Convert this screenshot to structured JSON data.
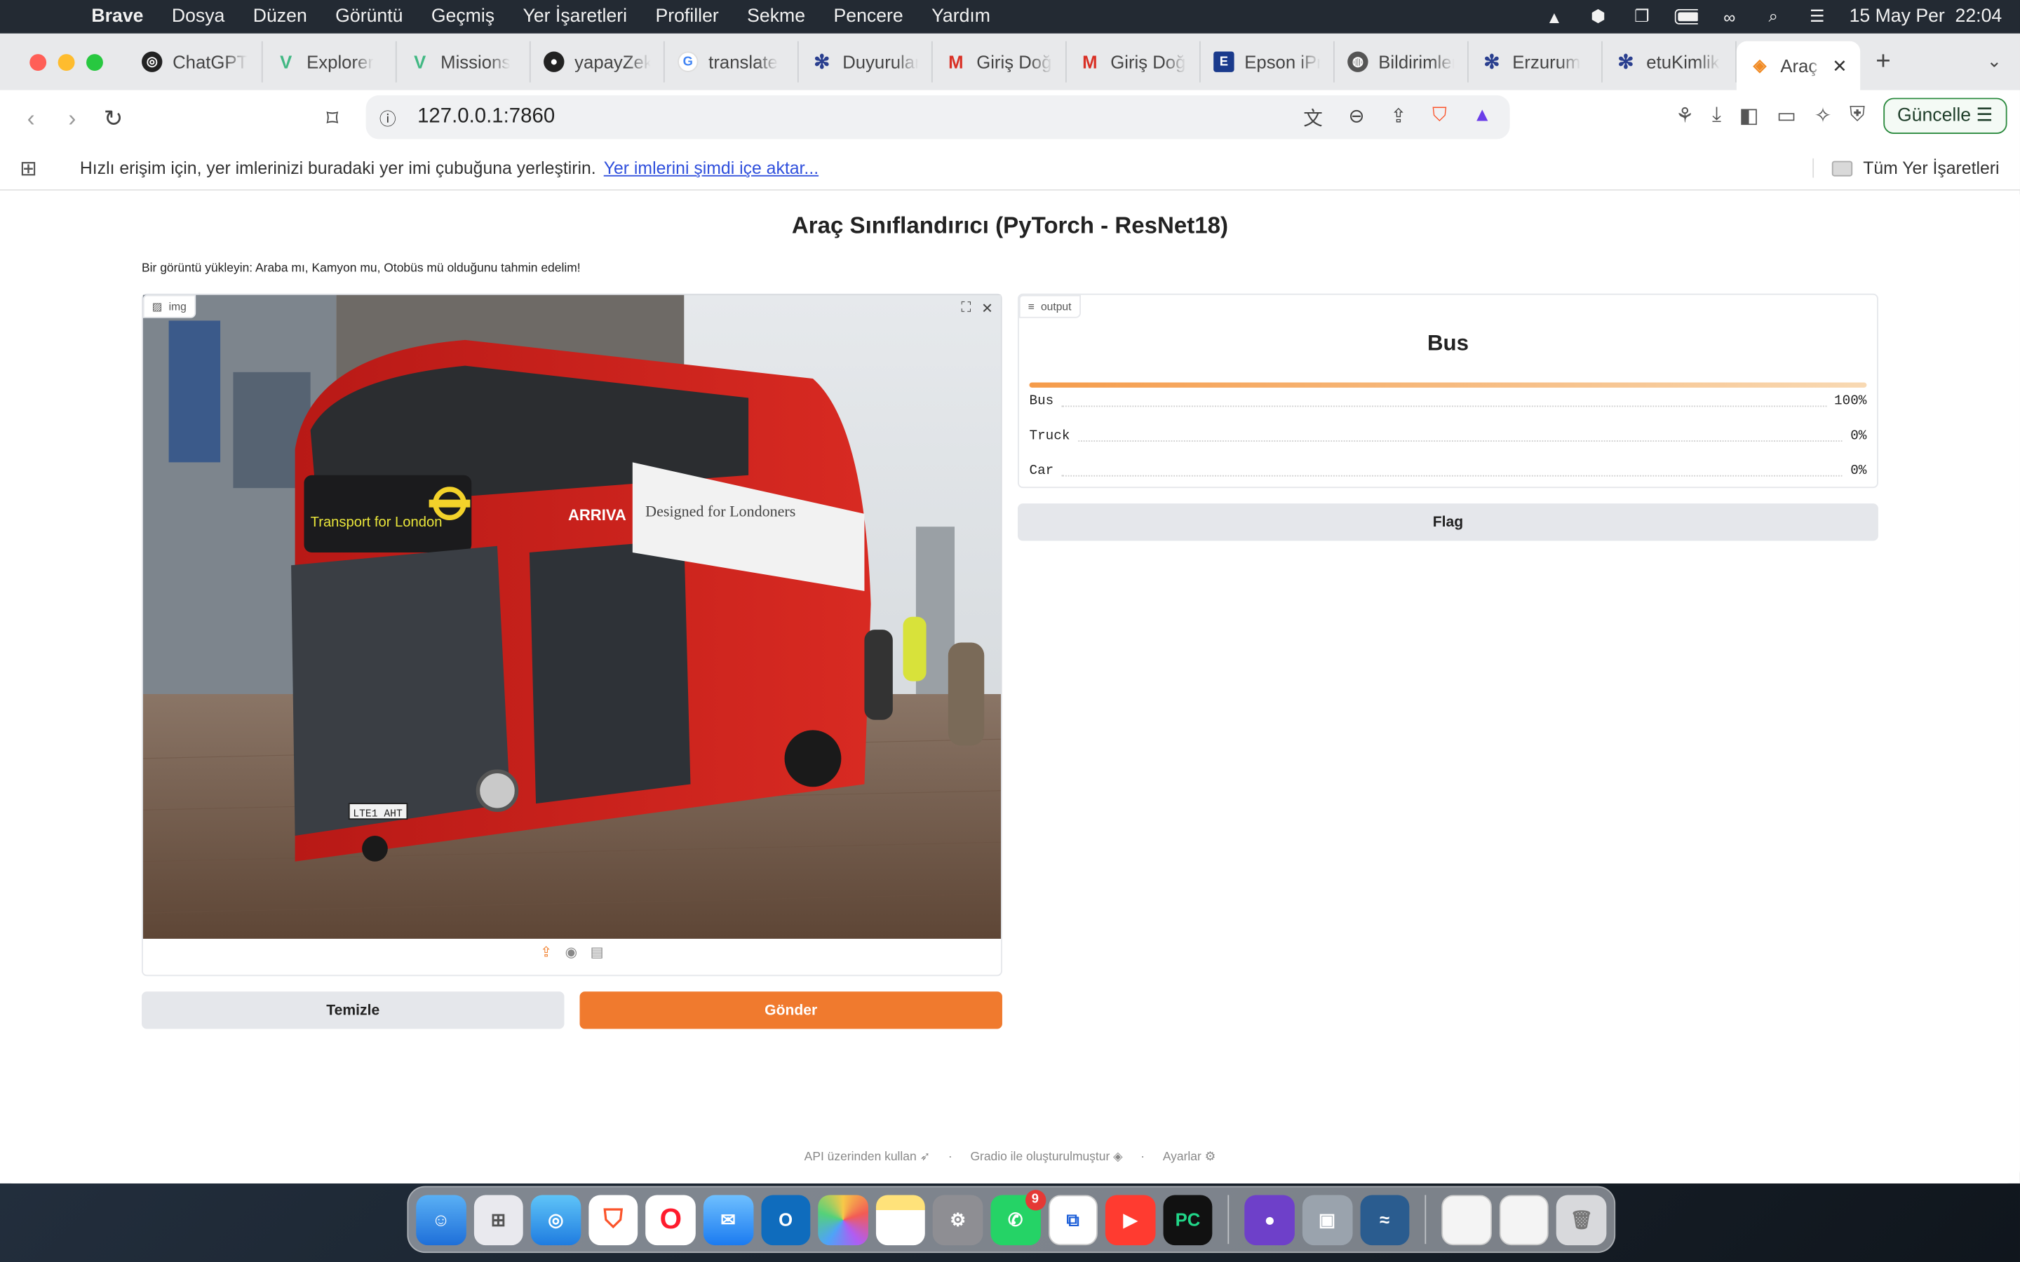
{
  "menubar": {
    "app_name": "Brave",
    "items": [
      "Dosya",
      "Düzen",
      "Görüntü",
      "Geçmiş",
      "Yer İşaretleri",
      "Profiller",
      "Sekme",
      "Pencere",
      "Yardım"
    ],
    "datetime": "15 May Per  22:04"
  },
  "tabs": [
    {
      "label": "ChatGPT",
      "icon": "chatgpt-icon"
    },
    {
      "label": "Explorer",
      "icon": "vue-icon"
    },
    {
      "label": "Missions",
      "icon": "vue-icon"
    },
    {
      "label": "yapayZeka",
      "icon": "github-icon"
    },
    {
      "label": "translate",
      "icon": "google-icon"
    },
    {
      "label": "Duyurular",
      "icon": "snowflake-icon"
    },
    {
      "label": "Giriş Doğrulama",
      "icon": "gmail-icon"
    },
    {
      "label": "Giriş Doğrulama",
      "icon": "gmail-icon"
    },
    {
      "label": "Epson iPrint",
      "icon": "epson-icon"
    },
    {
      "label": "Bildirimler",
      "icon": "globe-icon"
    },
    {
      "label": "Erzurum",
      "icon": "snowflake-icon"
    },
    {
      "label": "etuKimlik",
      "icon": "snowflake-icon"
    }
  ],
  "active_tab": {
    "label": "Araç Sınıflandırıcı",
    "icon": "gradio-icon"
  },
  "address": {
    "url": "127.0.0.1:7860"
  },
  "toolbar": {
    "update_label": "Güncelle"
  },
  "bookmarks_bar": {
    "message": "Hızlı erişim için, yer imlerinizi buradaki yer imi çubuğuna yerleştirin.",
    "import_link": "Yer imlerini şimdi içe aktar...",
    "all_bookmarks": "Tüm Yer İşaretleri"
  },
  "app": {
    "title": "Araç Sınıflandırıcı (PyTorch - ResNet18)",
    "description": "Bir görüntü yükleyin: Araba mı, Kamyon mu, Otobüs mü olduğunu tahmin edelim!",
    "input_label": "img",
    "output_label": "output",
    "prediction": "Bus",
    "confidences": [
      {
        "label": "Bus",
        "value": "100%"
      },
      {
        "label": "Truck",
        "value": "0%"
      },
      {
        "label": "Car",
        "value": "0%"
      }
    ],
    "image_texts": {
      "bus_destination": "Transport for London",
      "operator": "ARRIVA",
      "ad": "Designed for Londoners",
      "plate": "LTE1 AHT"
    },
    "clear_button": "Temizle",
    "submit_button": "Gönder",
    "flag_button": "Flag"
  },
  "footer": {
    "api": "API üzerinden kullan",
    "built": "Gradio ile oluşturulmuştur",
    "settings": "Ayarlar"
  },
  "dock": {
    "whatsapp_badge": "9"
  }
}
